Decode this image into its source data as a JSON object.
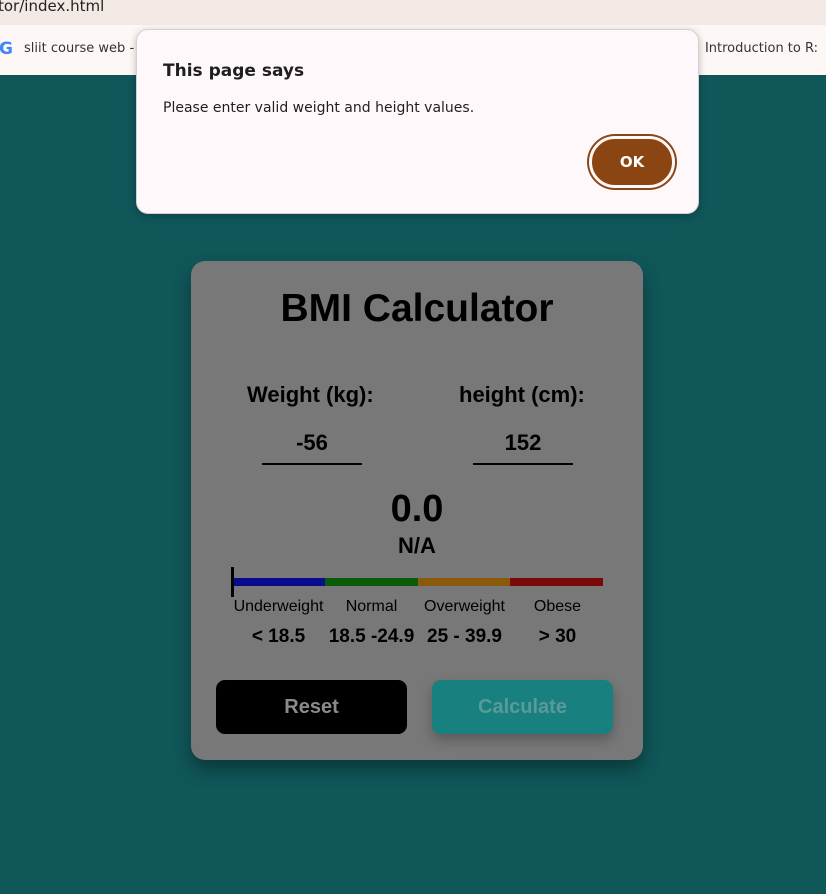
{
  "browser": {
    "url_fragment": "tor/index.html",
    "bookmarks": [
      {
        "label": "sliit course web -"
      },
      {
        "label": "Introduction to R:"
      }
    ]
  },
  "dialog": {
    "title": "This page says",
    "message": "Please enter valid weight and height values.",
    "ok_label": "OK",
    "ok_color": "#8b4513"
  },
  "calculator": {
    "title": "BMI Calculator",
    "weight_label": "Weight (kg):",
    "weight_value": "-56",
    "height_label": "height (cm):",
    "height_value": "152",
    "bmi_value": "0.0",
    "bmi_status": "N/A",
    "categories": [
      {
        "label": "Underweight",
        "range": "< 18.5",
        "color": "#0a0a8c"
      },
      {
        "label": "Normal",
        "range": "18.5 -24.9",
        "color": "#0a5a0a"
      },
      {
        "label": "Overweight",
        "range": "25 - 39.9",
        "color": "#8a5a0a"
      },
      {
        "label": "Obese",
        "range": "> 30",
        "color": "#7a0a0a"
      }
    ],
    "reset_label": "Reset",
    "calculate_label": "Calculate"
  },
  "colors": {
    "page_background": "#10575a",
    "card_background": "#787878"
  }
}
